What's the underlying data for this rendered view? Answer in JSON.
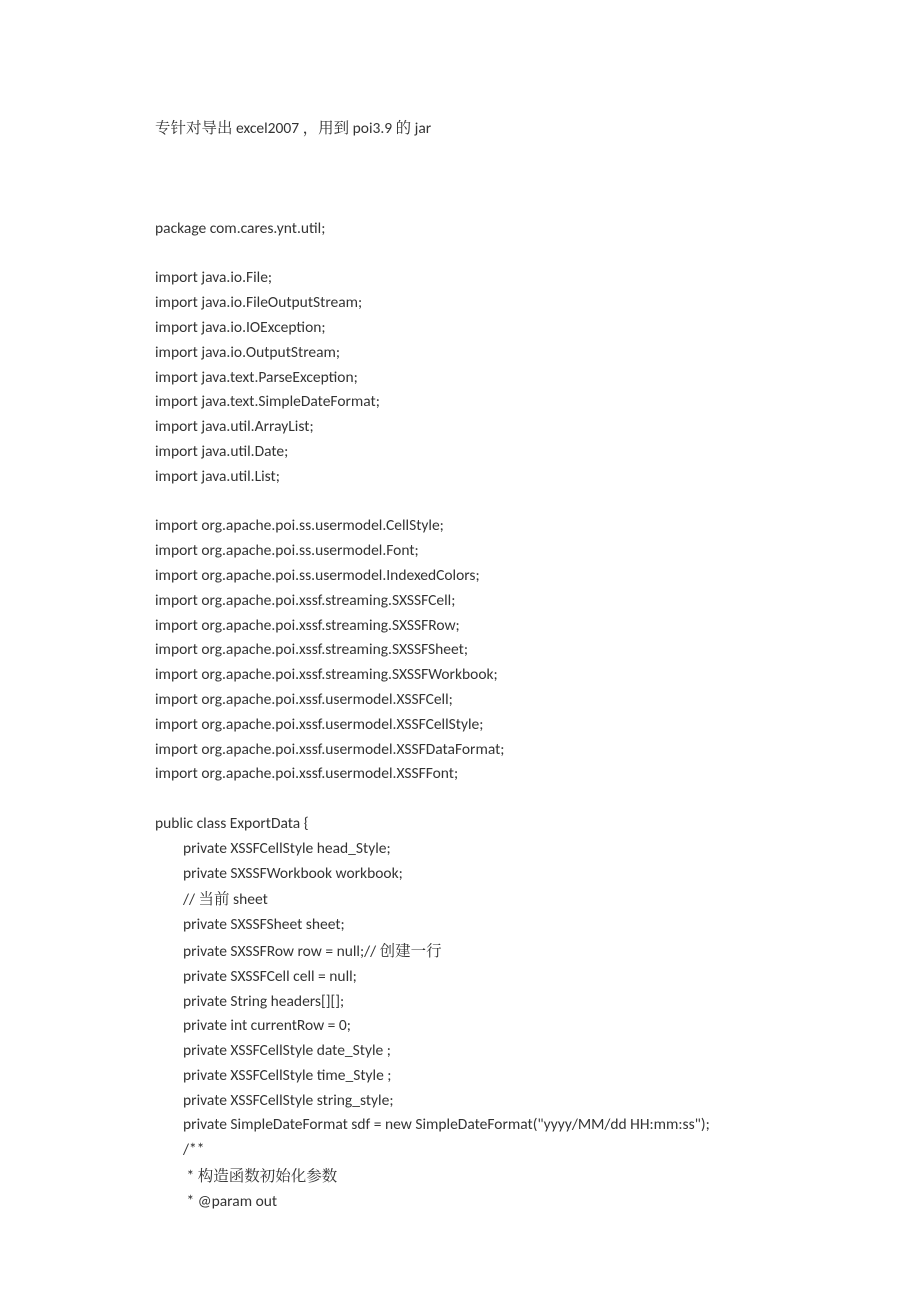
{
  "intro": {
    "p1": "专针对导出",
    "p2": " excel2007 ",
    "p3": "，用到",
    "p4": " poi3.9 ",
    "p5": "的",
    "p6": " jar"
  },
  "code": {
    "l01": "package com.cares.ynt.util;",
    "l02": "",
    "l03": "import java.io.File;",
    "l04": "import java.io.FileOutputStream;",
    "l05": "import java.io.IOException;",
    "l06": "import java.io.OutputStream;",
    "l07": "import java.text.ParseException;",
    "l08": "import java.text.SimpleDateFormat;",
    "l09": "import java.util.ArrayList;",
    "l10": "import java.util.Date;",
    "l11": "import java.util.List;",
    "l12": "",
    "l13": "import org.apache.poi.ss.usermodel.CellStyle;",
    "l14": "import org.apache.poi.ss.usermodel.Font;",
    "l15": "import org.apache.poi.ss.usermodel.IndexedColors;",
    "l16": "import org.apache.poi.xssf.streaming.SXSSFCell;",
    "l17": "import org.apache.poi.xssf.streaming.SXSSFRow;",
    "l18": "import org.apache.poi.xssf.streaming.SXSSFSheet;",
    "l19": "import org.apache.poi.xssf.streaming.SXSSFWorkbook;",
    "l20": "import org.apache.poi.xssf.usermodel.XSSFCell;",
    "l21": "import org.apache.poi.xssf.usermodel.XSSFCellStyle;",
    "l22": "import org.apache.poi.xssf.usermodel.XSSFDataFormat;",
    "l23": "import org.apache.poi.xssf.usermodel.XSSFFont;",
    "l24": "",
    "l25": "public class ExportData {",
    "l26": "        private XSSFCellStyle head_Style;",
    "l27": "        private SXSSFWorkbook workbook;",
    "l28a": "        // ",
    "l28b": "当前",
    "l28c": " sheet",
    "l29": "        private SXSSFSheet sheet;",
    "l30a": "        private SXSSFRow row = null;// ",
    "l30b": "创建一行",
    "l31": "        private SXSSFCell cell = null;",
    "l32": "        private String headers[][];",
    "l33": "        private int currentRow = 0;",
    "l34": "        private XSSFCellStyle date_Style ;",
    "l35": "        private XSSFCellStyle time_Style ;",
    "l36": "        private XSSFCellStyle string_style;",
    "l37": "        private SimpleDateFormat sdf = new SimpleDateFormat(\"yyyy/MM/dd HH:mm:ss\");",
    "l38": "        /**",
    "l39a": "         * ",
    "l39b": "构造函数初始化参数",
    "l40": "         * @param out"
  }
}
